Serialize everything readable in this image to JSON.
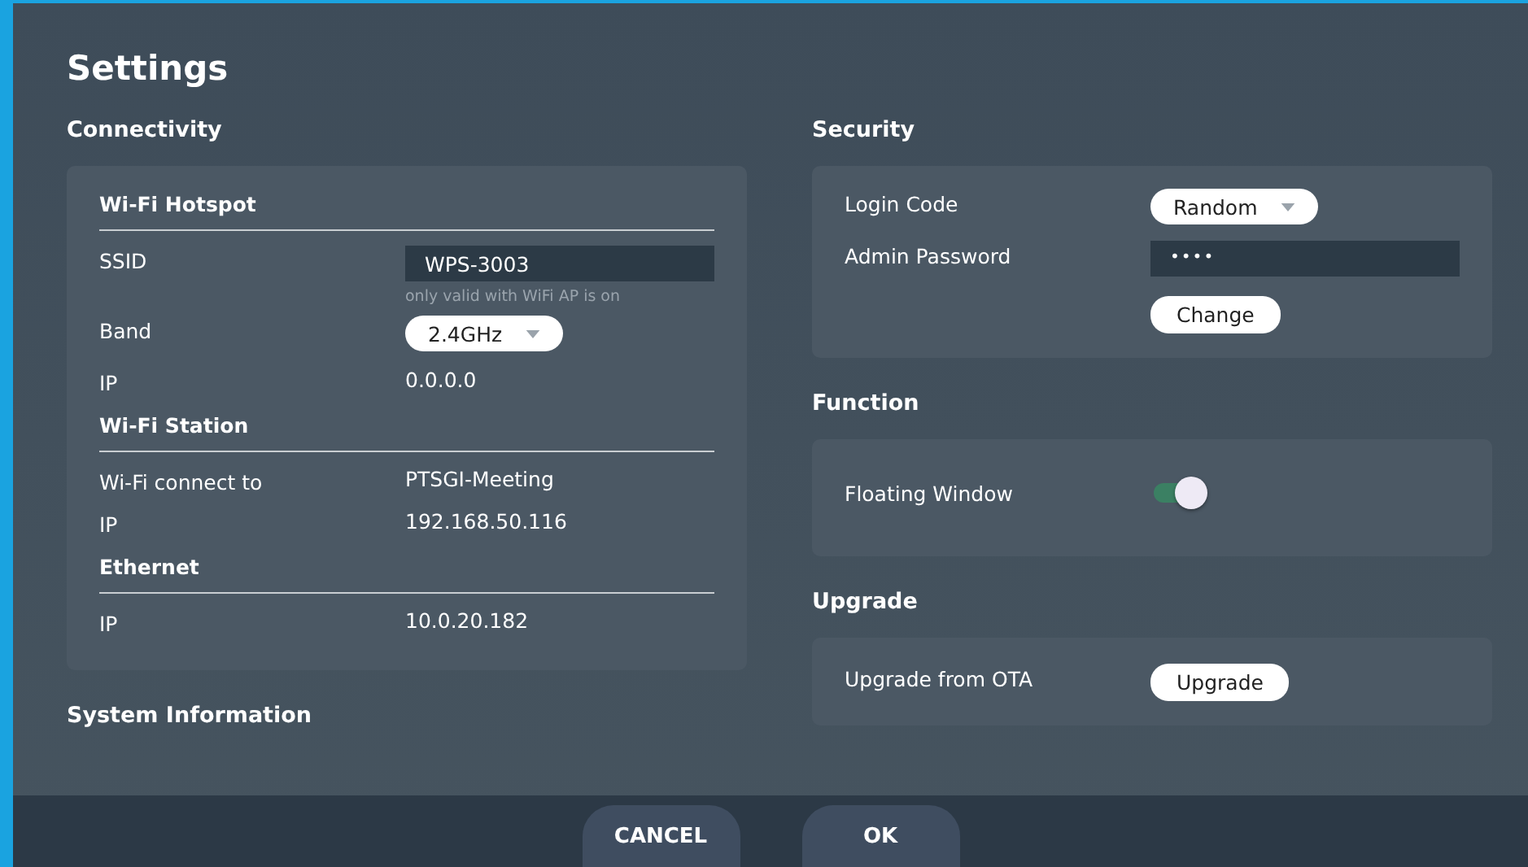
{
  "title": "Settings",
  "columns": [
    [
      {
        "heading": "Connectivity",
        "groups": [
          {
            "title": "Wi-Fi Hotspot",
            "rows": [
              {
                "kind": "input",
                "label": "SSID",
                "value": "WPS-3003",
                "hint": "only valid with WiFi AP is on"
              },
              {
                "kind": "dropdown",
                "label": "Band",
                "value": "2.4GHz"
              },
              {
                "kind": "text",
                "label": "IP",
                "value": "0.0.0.0"
              }
            ]
          },
          {
            "title": "Wi-Fi Station",
            "rows": [
              {
                "kind": "text",
                "label": "Wi-Fi connect to",
                "value": "PTSGI-Meeting"
              },
              {
                "kind": "text",
                "label": "IP",
                "value": "192.168.50.116"
              }
            ]
          },
          {
            "title": "Ethernet",
            "rows": [
              {
                "kind": "text",
                "label": "IP",
                "value": "10.0.20.182"
              }
            ]
          }
        ]
      },
      {
        "heading": "System Information"
      }
    ],
    [
      {
        "heading": "Security",
        "groups": [
          {
            "rows": [
              {
                "kind": "dropdown",
                "label": "Login Code",
                "value": "Random"
              },
              {
                "kind": "password",
                "label": "Admin Password",
                "value": "••••"
              },
              {
                "kind": "button",
                "value": "Change"
              }
            ]
          }
        ]
      },
      {
        "heading": "Function",
        "groups": [
          {
            "rows": [
              {
                "kind": "toggle",
                "label": "Floating Window",
                "on": true
              }
            ]
          }
        ]
      },
      {
        "heading": "Upgrade",
        "groups": [
          {
            "rows": [
              {
                "kind": "button",
                "label": "Upgrade from OTA",
                "value": "Upgrade"
              }
            ]
          }
        ]
      }
    ]
  ],
  "buttons": [
    "CANCEL",
    "OK"
  ]
}
